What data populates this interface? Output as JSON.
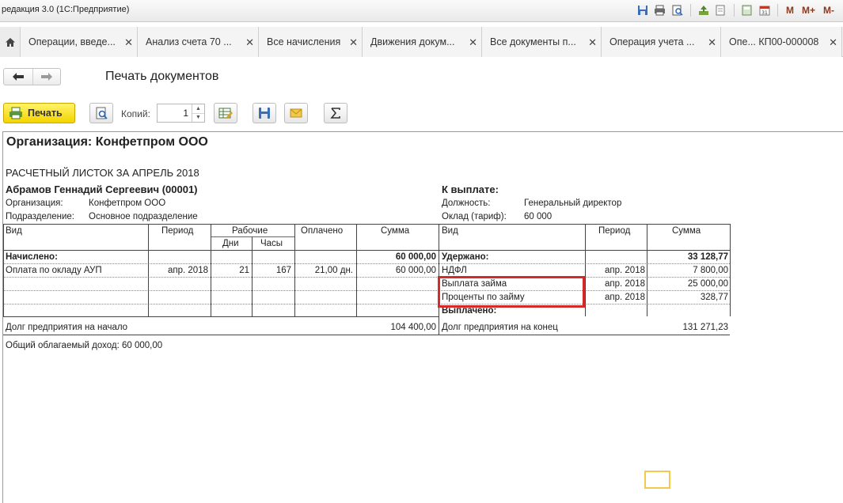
{
  "window": {
    "title": "редакция 3.0  (1С:Предприятие)"
  },
  "titlebar": {
    "m": "M",
    "m_plus": "M+",
    "m_minus": "M-"
  },
  "tabs": [
    {
      "label": "Операции, введе..."
    },
    {
      "label": "Анализ счета 70 ..."
    },
    {
      "label": "Все начисления"
    },
    {
      "label": "Движения докум..."
    },
    {
      "label": "Все документы п..."
    },
    {
      "label": "Операция учета ..."
    },
    {
      "label": "Опе... КП00-000008"
    }
  ],
  "page": {
    "title": "Печать документов"
  },
  "toolbar": {
    "print_label": "Печать",
    "copies_label": "Копий:",
    "copies_value": "1"
  },
  "doc": {
    "org_title": "Организация: Конфетпром ООО",
    "sheet_title": "РАСЧЕТНЫЙ ЛИСТОК ЗА АПРЕЛЬ 2018",
    "employee": "Абрамов Геннадий Сергеевич (00001)",
    "to_pay_label": "К выплате:",
    "org_label": "Организация:",
    "org_value": "Конфетпром ООО",
    "dept_label": "Подразделение:",
    "dept_value": "Основное подразделение",
    "position_label": "Должность:",
    "position_value": "Генеральный директор",
    "salary_label": "Оклад (тариф):",
    "salary_value": "60 000",
    "headers": {
      "vid": "Вид",
      "period": "Период",
      "working": "Рабочие",
      "days": "Дни",
      "hours": "Часы",
      "paid": "Оплачено",
      "sum": "Сумма",
      "vid2": "Вид",
      "period2": "Период",
      "sum2": "Сумма"
    },
    "accrued_label": "Начислено:",
    "accrued_total": "60 000,00",
    "withheld_label": "Удержано:",
    "withheld_total": "33 128,77",
    "accruals": [
      {
        "vid": "Оплата по окладу АУП",
        "period": "апр. 2018",
        "days": "21",
        "hours": "167",
        "paid": "21,00 дн.",
        "sum": "60 000,00"
      }
    ],
    "withholdings": [
      {
        "vid": "НДФЛ",
        "period": "апр. 2018",
        "sum": "7 800,00"
      },
      {
        "vid": "Выплата займа",
        "period": "апр. 2018",
        "sum": "25 000,00"
      },
      {
        "vid": "Проценты по займу",
        "period": "апр. 2018",
        "sum": "328,77"
      }
    ],
    "paid_out_label": "Выплачено:",
    "debt_start_label": "Долг предприятия на начало",
    "debt_start_value": "104 400,00",
    "debt_end_label": "Долг предприятия на конец",
    "debt_end_value": "131 271,23",
    "taxable_income": "Общий облагаемый доход: 60 000,00"
  }
}
